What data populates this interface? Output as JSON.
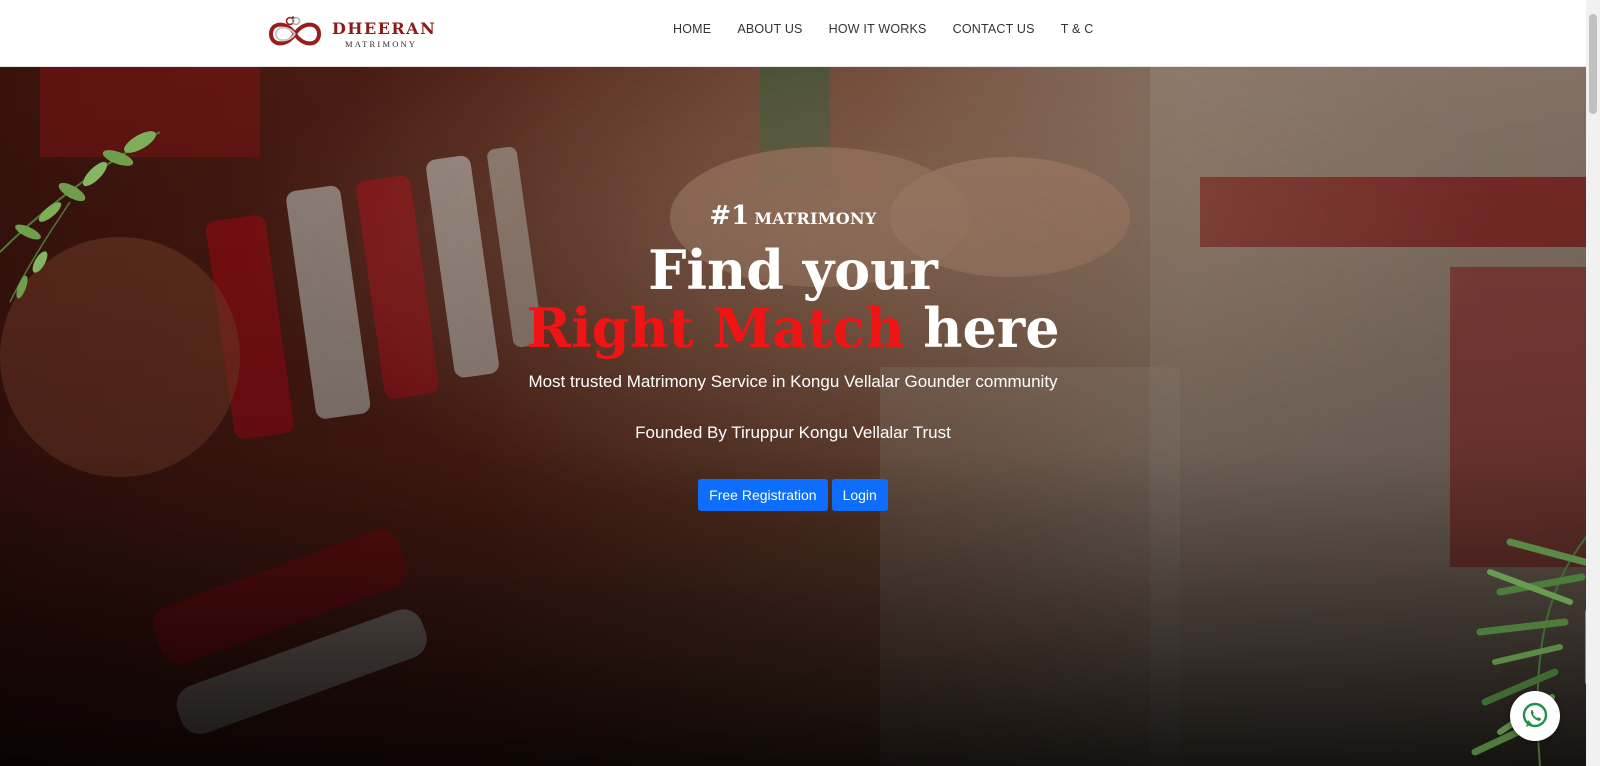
{
  "brand": {
    "title": "DHEERAN",
    "subtitle": "MATRIMONY",
    "logo_icon": "infinity-rings-icon",
    "color": "#8e1a1a"
  },
  "nav": {
    "items": [
      {
        "label": "HOME"
      },
      {
        "label": "ABOUT US"
      },
      {
        "label": "HOW IT WORKS"
      },
      {
        "label": "CONTACT US"
      },
      {
        "label": "T & C"
      }
    ]
  },
  "hero": {
    "tag_number": "#1",
    "tag_text": "MATRIMONY",
    "headline_line1": "Find your",
    "headline_accent": "Right Match",
    "headline_rest": "here",
    "subtitle": "Most trusted Matrimony Service in Kongu Vellalar Gounder community",
    "founded": "Founded By Tiruppur Kongu Vellalar Trust",
    "buttons": {
      "register": "Free Registration",
      "login": "Login"
    },
    "background_image": "wedding-hands-photo"
  },
  "floating": {
    "chat_icon": "whatsapp-icon"
  },
  "colors": {
    "accent_red": "#f01414",
    "button_blue": "#0d6efd",
    "brand_maroon": "#8e1a1a"
  }
}
